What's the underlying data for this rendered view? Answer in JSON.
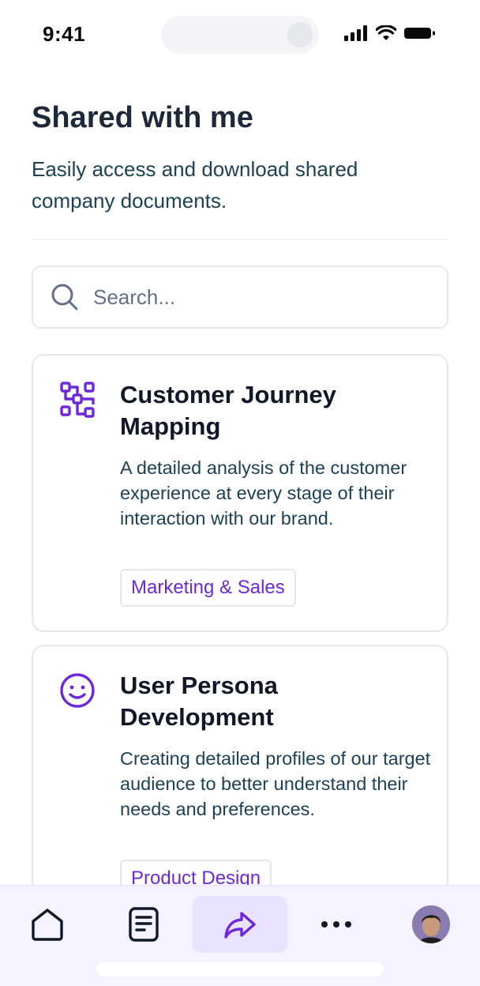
{
  "status_bar": {
    "time": "9:41",
    "icons": [
      "signal-icon",
      "wifi-icon",
      "battery-icon"
    ]
  },
  "header": {
    "title": "Shared with me",
    "subtitle": "Easily access and download shared company documents."
  },
  "search": {
    "placeholder": "Search...",
    "value": "",
    "icon": "search-icon"
  },
  "documents": [
    {
      "icon": "qr-structure-icon",
      "title": "Customer Journey Mapping",
      "description": "A detailed analysis of the customer experience at every stage of their interaction with our brand.",
      "tag": "Marketing & Sales"
    },
    {
      "icon": "smile-icon",
      "title": "User Persona Development",
      "description": "Creating detailed profiles of our target audience to better understand their needs and preferences.",
      "tag": "Product Design"
    }
  ],
  "bottom_nav": {
    "items": [
      {
        "name": "home",
        "icon": "home-icon",
        "active": false
      },
      {
        "name": "documents",
        "icon": "document-icon",
        "active": false
      },
      {
        "name": "shared",
        "icon": "share-icon",
        "active": true
      },
      {
        "name": "more",
        "icon": "more-icon",
        "active": false
      },
      {
        "name": "profile",
        "icon": "avatar",
        "active": false
      }
    ]
  },
  "colors": {
    "accent": "#6d28d9",
    "accent_bg": "#e9e3ff",
    "nav_bg": "#f4f3ff",
    "title": "#1d2939",
    "body_text": "#1d4155",
    "border": "#e4e7ec"
  }
}
